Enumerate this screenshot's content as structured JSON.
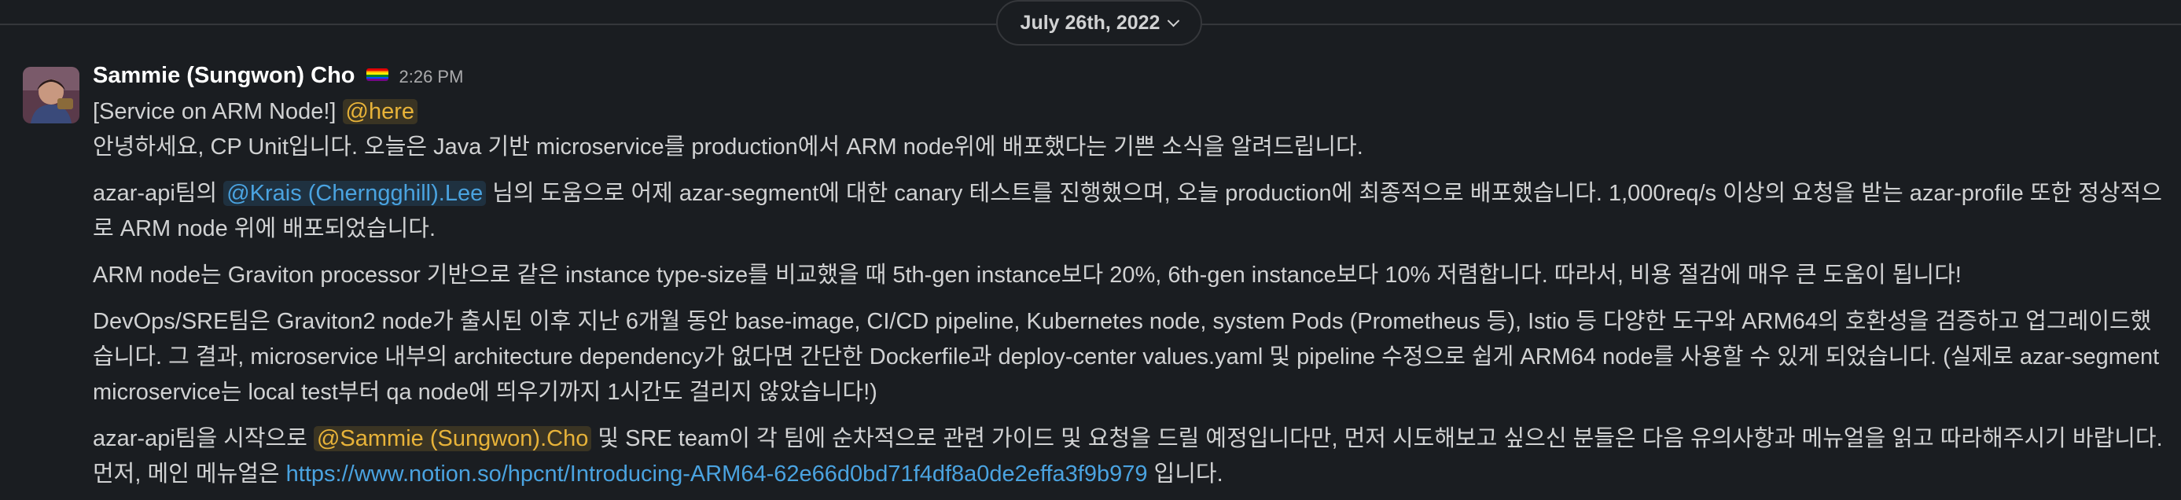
{
  "date_divider": {
    "label": "July 26th, 2022"
  },
  "message": {
    "sender": "Sammie (Sungwon) Cho",
    "timestamp": "2:26 PM",
    "line1_title": "[Service on ARM Node!]",
    "line1_mention": "@here",
    "line2": "안녕하세요, CP Unit입니다. 오늘은 Java 기반 microservice를 production에서 ARM node위에 배포했다는 기쁜 소식을 알려드립니다.",
    "p2_a": "azar-api팀의 ",
    "p2_mention": "@Krais (Cherngghill).Lee",
    "p2_b": " 님의 도움으로 어제 azar-segment에 대한 canary 테스트를 진행했으며, 오늘 production에 최종적으로 배포했습니다. 1,000req/s 이상의 요청을 받는 azar-profile 또한 정상적으로 ARM node 위에 배포되었습니다.",
    "p3": "ARM node는 Graviton processor 기반으로 같은 instance type-size를 비교했을 때 5th-gen instance보다 20%, 6th-gen instance보다 10% 저렴합니다. 따라서, 비용 절감에 매우 큰 도움이 됩니다!",
    "p4": "DevOps/SRE팀은 Graviton2 node가 출시된 이후 지난 6개월 동안 base-image, CI/CD pipeline, Kubernetes node, system Pods (Prometheus 등), Istio 등 다양한 도구와 ARM64의 호환성을 검증하고 업그레이드했습니다. 그 결과, microservice 내부의 architecture dependency가 없다면 간단한 Dockerfile과 deploy-center values.yaml 및 pipeline 수정으로 쉽게 ARM64 node를 사용할 수 있게 되었습니다. (실제로 azar-segment microservice는 local test부터 qa node에 띄우기까지 1시간도 걸리지 않았습니다!)",
    "p5_a": "azar-api팀을 시작으로 ",
    "p5_mention": "@Sammie (Sungwon).Cho",
    "p5_b": " 및 SRE team이 각 팀에 순차적으로 관련 가이드 및 요청을 드릴 예정입니다만, 먼저 시도해보고 싶으신 분들은 다음 유의사항과 메뉴얼을 읽고 따라해주시기 바랍니다.",
    "p6_a": "먼저, 메인 메뉴얼은 ",
    "p6_link": "https://www.notion.so/hpcnt/Introducing-ARM64-62e66d0bd71f4df8a0de2effa3f9b979",
    "p6_b": " 입니다."
  },
  "icons": {
    "date_chevron": "chevron-down-icon",
    "sender_flag": "rainbow-flag-icon",
    "avatar": "user-avatar"
  },
  "colors": {
    "background": "#1a1d21",
    "mention_yellow": "#e8b339",
    "mention_blue": "#4aa3e0",
    "link": "#4aa3e0"
  }
}
